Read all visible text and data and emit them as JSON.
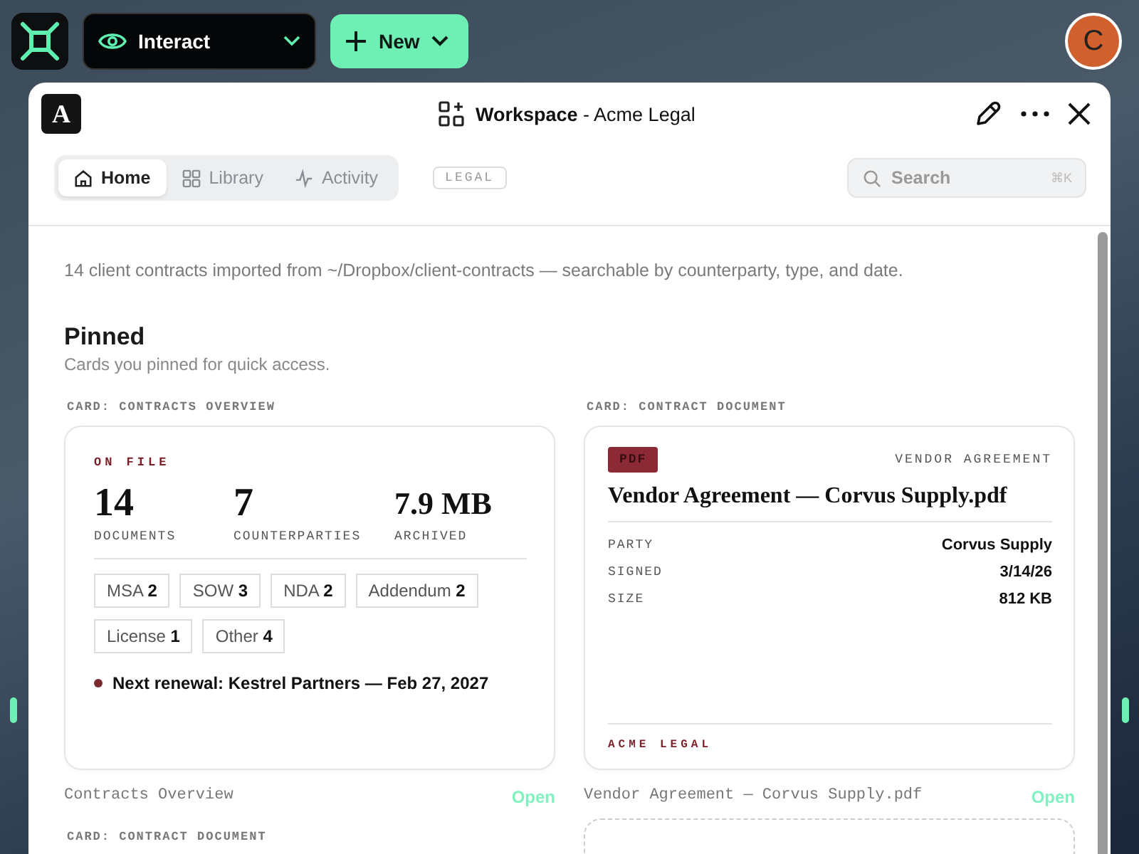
{
  "topbar": {
    "mode": {
      "label": "Interact"
    },
    "new_button": {
      "label": "New"
    },
    "avatar": {
      "initial": "C"
    }
  },
  "window": {
    "title": "**Workspace** - Acme Legal",
    "logo": "A",
    "tabs": [
      {
        "label": "Home",
        "selected": true,
        "kind": "home"
      },
      {
        "label": "Library",
        "selected": false,
        "kind": "library"
      },
      {
        "label": "Activity",
        "selected": false,
        "kind": "activity"
      }
    ],
    "badge": "LEGAL",
    "search": {
      "placeholder": "Search",
      "shortcut": "⌘K"
    }
  },
  "intro": "14 client contracts imported from ~/Dropbox/client-contracts — searchable by counterparty, type, and date.",
  "section": {
    "title": "Pinned",
    "subtitle": "Cards you pinned for quick access."
  },
  "cards": [
    {
      "kind": "overview",
      "caption": "CARD: CONTRACTS OVERVIEW",
      "eyebrow": "ON FILE",
      "stats": [
        {
          "value": "14",
          "label": "DOCUMENTS"
        },
        {
          "value": "7",
          "label": "COUNTERPARTIES"
        },
        {
          "value": "7.9 MB",
          "label": "ARCHIVED"
        }
      ],
      "tags": [
        {
          "label": "MSA",
          "count": "2"
        },
        {
          "label": "SOW",
          "count": "3"
        },
        {
          "label": "NDA",
          "count": "2"
        },
        {
          "label": "Addendum",
          "count": "2"
        },
        {
          "label": "License",
          "count": "1"
        },
        {
          "label": "Other",
          "count": "4"
        }
      ],
      "note": "Next renewal: Kestrel Partners — Feb 27, 2027",
      "footer_title": "Contracts Overview",
      "footer_action": "Open"
    },
    {
      "kind": "document",
      "caption": "CARD: CONTRACT DOCUMENT",
      "file_type": "PDF",
      "doc_type": "VENDOR AGREEMENT",
      "title": "Vendor Agreement — Corvus Supply.pdf",
      "fields": [
        {
          "label": "PARTY",
          "value": "Corvus Supply"
        },
        {
          "label": "SIGNED",
          "value": "3/14/26"
        },
        {
          "label": "SIZE",
          "value": "812 KB"
        }
      ],
      "owner": "ACME LEGAL",
      "footer_title": "Vendor Agreement — Corvus Supply.pdf",
      "footer_action": "Open"
    },
    {
      "kind": "document_partial",
      "caption": "CARD: CONTRACT DOCUMENT"
    },
    {
      "kind": "placeholder"
    }
  ]
}
